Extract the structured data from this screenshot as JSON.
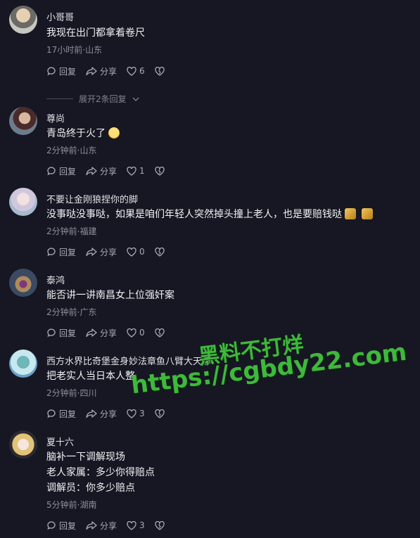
{
  "comments": [
    {
      "avatar": "user-avatar",
      "name": "小哥哥",
      "lines": [
        "我现在出门都拿着卷尺"
      ],
      "meta": "17小时前·山东",
      "reply": "回复",
      "share": "分享",
      "likes": "6",
      "replies_toggle": "展开2条回复"
    },
    {
      "avatar": "user-avatar",
      "name": "尊尚",
      "lines": [
        "青岛终于火了"
      ],
      "emoji": "grinning-face-emoji",
      "meta": "2分钟前·山东",
      "reply": "回复",
      "share": "分享",
      "likes": "1"
    },
    {
      "avatar": "user-avatar",
      "name": "不要让金刚狼捏你的脚",
      "lines": [
        "没事哒没事哒，如果是咱们年轻人突然掉头撞上老人，也是要赔钱哒"
      ],
      "emoji": "gold-emoji",
      "meta": "2分钟前·福建",
      "reply": "回复",
      "share": "分享",
      "likes": "0"
    },
    {
      "avatar": "user-avatar",
      "name": "泰鸿",
      "lines": [
        "能否讲一讲南昌女上位强奸案"
      ],
      "meta": "2分钟前·广东",
      "reply": "回复",
      "share": "分享",
      "likes": "0"
    },
    {
      "avatar": "user-avatar",
      "name": "西方水界比奇堡金身妙法章鱼八臂大天尊",
      "lines": [
        "把老实人当日本人整"
      ],
      "meta": "2分钟前·四川",
      "reply": "回复",
      "share": "分享",
      "likes": "3"
    },
    {
      "avatar": "user-avatar",
      "name": "夏十六",
      "lines": [
        "脑补一下调解现场",
        "老人家属：多少你得赔点",
        "调解员：你多少赔点"
      ],
      "meta": "5分钟前·湖南",
      "reply": "回复",
      "share": "分享",
      "likes": "3"
    }
  ],
  "watermark": {
    "line1": "黑料不打烊",
    "line2": "https://cgbdy22.com"
  },
  "colors": {
    "background": "#161722",
    "text": "#f1f1f5",
    "meta": "#8d8f9a",
    "watermark": "#3fb83c"
  }
}
